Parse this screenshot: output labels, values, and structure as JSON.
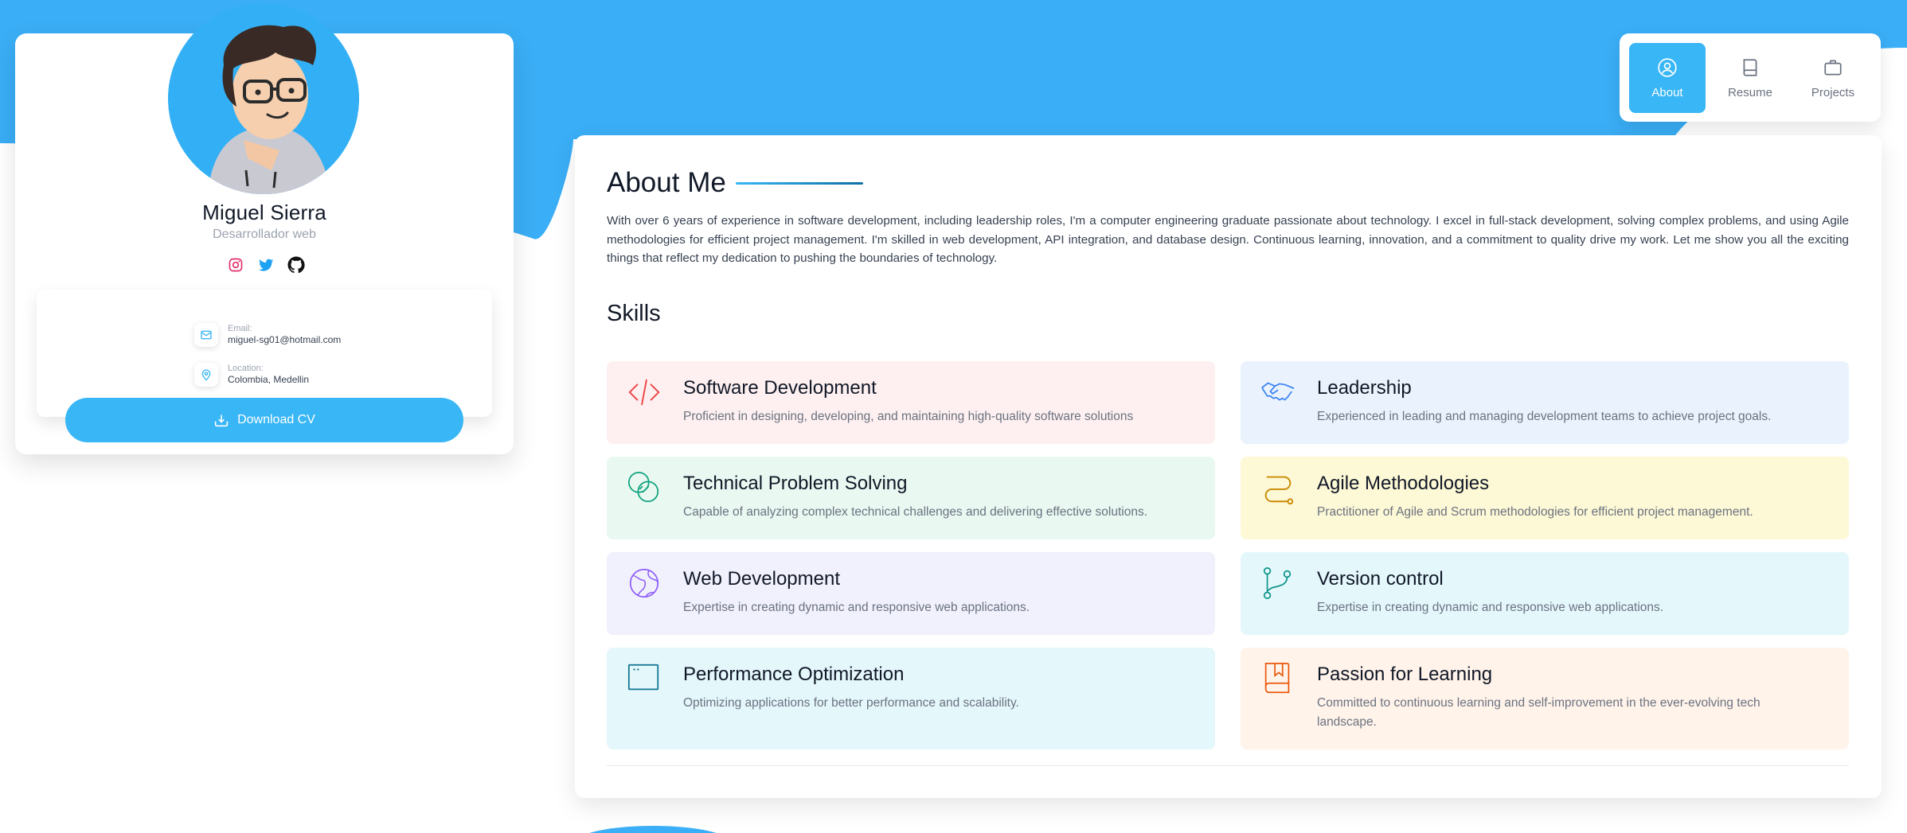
{
  "colors": {
    "accent": "#38b6f6",
    "accent_dark": "#0e6ea6",
    "background_wave": "#3aaef6"
  },
  "profile": {
    "name": "Miguel Sierra",
    "role": "Desarrollador web",
    "avatar_icon": "cartoon-avatar",
    "socials": [
      {
        "icon": "instagram-icon",
        "color": "#e1306c"
      },
      {
        "icon": "twitter-icon",
        "color": "#1da1f2"
      },
      {
        "icon": "github-icon",
        "color": "#111111"
      }
    ],
    "contact": {
      "email_label": "Email:",
      "email_value": "miguel-sg01@hotmail.com",
      "location_label": "Location:",
      "location_value": "Colombia, Medellin"
    },
    "download_label": "Download CV"
  },
  "nav": {
    "items": [
      {
        "label": "About",
        "icon": "user-circle-icon",
        "active": true
      },
      {
        "label": "Resume",
        "icon": "book-icon",
        "active": false
      },
      {
        "label": "Projects",
        "icon": "briefcase-icon",
        "active": false
      }
    ]
  },
  "about": {
    "title": "About Me",
    "text": "With over 6 years of experience in software development, including leadership roles, I'm a computer engineering graduate passionate about technology. I excel in full-stack development, solving complex problems, and using Agile methodologies for efficient project management. I'm skilled in web development, API integration, and database design. Continuous learning, innovation, and a commitment to quality drive my work. Let me show you all the exciting things that reflect my dedication to pushing the boundaries of technology.",
    "skills_title": "Skills",
    "skills": [
      {
        "title": "Software Development",
        "desc": "Proficient in designing, developing, and maintaining high-quality software solutions",
        "icon": "code-icon",
        "bg": "#fef0f0",
        "color": "#ef4444"
      },
      {
        "title": "Leadership",
        "desc": "Experienced in leading and managing development teams to achieve project goals.",
        "icon": "handshake-icon",
        "bg": "#eaf3fd",
        "color": "#3b82f6"
      },
      {
        "title": "Technical Problem Solving",
        "desc": "Capable of analyzing complex technical challenges and delivering effective solutions.",
        "icon": "intersect-circles-icon",
        "bg": "#e9f8f1",
        "color": "#10a37f"
      },
      {
        "title": "Agile Methodologies",
        "desc": "Practitioner of Agile and Scrum methodologies for efficient project management.",
        "icon": "route-icon",
        "bg": "#fdf8d5",
        "color": "#ca8a04"
      },
      {
        "title": "Web Development",
        "desc": "Expertise in creating dynamic and responsive web applications.",
        "icon": "globe-icon",
        "bg": "#f1f0fd",
        "color": "#8b5cf6"
      },
      {
        "title": "Version control",
        "desc": "Expertise in creating dynamic and responsive web applications.",
        "icon": "git-branch-icon",
        "bg": "#e4f8fc",
        "color": "#0d9488"
      },
      {
        "title": "Performance Optimization",
        "desc": "Optimizing applications for better performance and scalability.",
        "icon": "browser-window-icon",
        "bg": "#e4f7fb",
        "color": "#0e7490"
      },
      {
        "title": "Passion for Learning",
        "desc": "Committed to continuous learning and self-improvement in the ever-evolving tech landscape.",
        "icon": "bookmark-book-icon",
        "bg": "#fff3ea",
        "color": "#ea580c"
      }
    ]
  }
}
